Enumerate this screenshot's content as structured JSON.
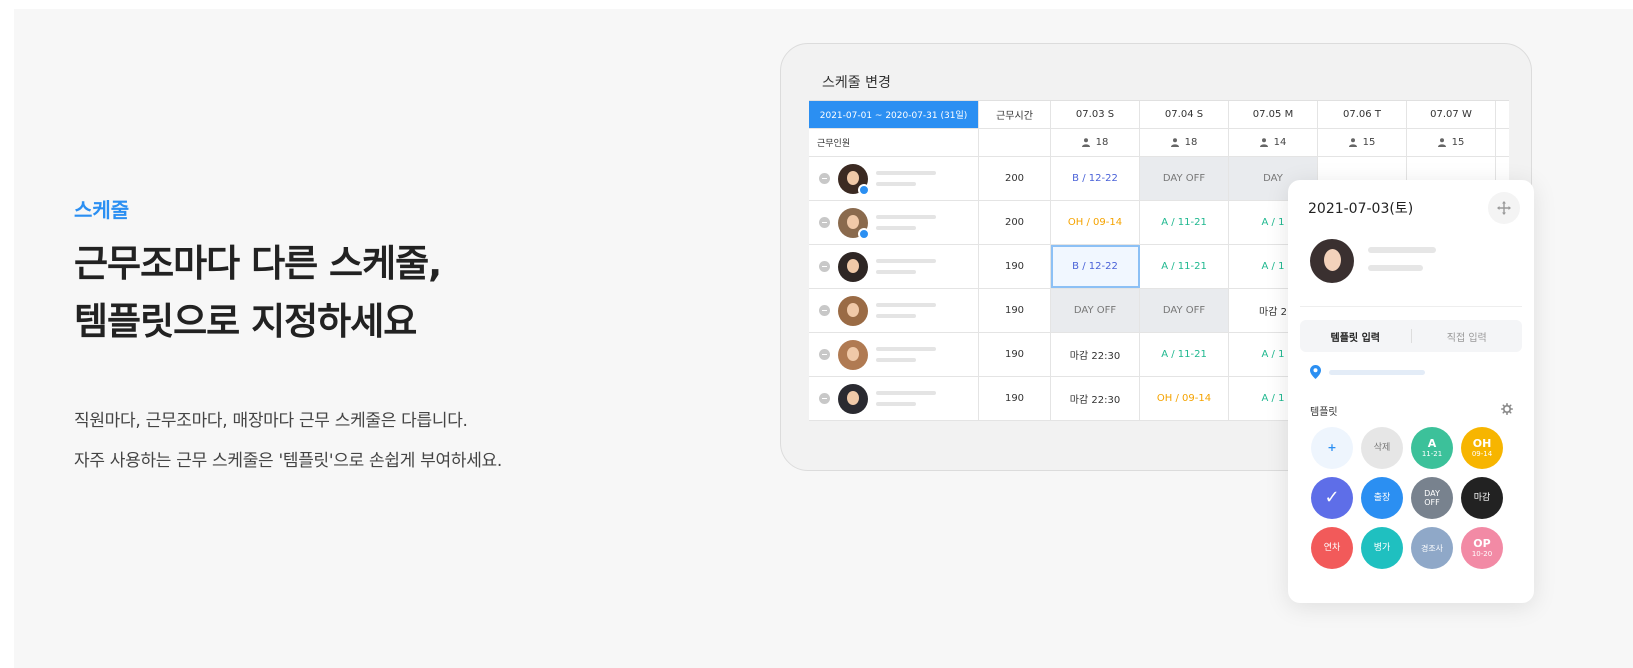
{
  "left": {
    "eyebrow": "스케줄",
    "headline_line1": "근무조마다 다른 스케줄,",
    "headline_line2": "템플릿으로 지정하세요",
    "desc_line1": "직원마다, 근무조마다, 매장마다 근무 스케줄은 다릅니다.",
    "desc_line2": "자주 사용하는 근무 스케줄은 '템플릿'으로 손쉽게 부여하세요."
  },
  "schedule": {
    "title": "스케줄 변경",
    "range": "2021-07-01 ~ 2020-07-31 (31일)",
    "hours_header": "근무시간",
    "dates": [
      "07.03 S",
      "07.04 S",
      "07.05 M",
      "07.06 T",
      "07.07 W"
    ],
    "staff_label": "근무인원",
    "counts": [
      "18",
      "18",
      "14",
      "15",
      "15"
    ],
    "rows": [
      {
        "hours": "200",
        "cells": [
          "B / 12-22",
          "DAY OFF",
          "DAY",
          "",
          ""
        ]
      },
      {
        "hours": "200",
        "cells": [
          "OH / 09-14",
          "A / 11-21",
          "A / 1",
          "",
          ""
        ]
      },
      {
        "hours": "190",
        "cells": [
          "B / 12-22",
          "A / 11-21",
          "A / 1",
          "",
          ""
        ]
      },
      {
        "hours": "190",
        "cells": [
          "DAY OFF",
          "DAY OFF",
          "마감 2",
          "",
          ""
        ]
      },
      {
        "hours": "190",
        "cells": [
          "마감 22:30",
          "A / 11-21",
          "A / 1",
          "",
          ""
        ]
      },
      {
        "hours": "190",
        "cells": [
          "마감 22:30",
          "OH / 09-14",
          "A / 1",
          "",
          ""
        ]
      }
    ]
  },
  "popup": {
    "date": "2021-07-03(토)",
    "tab_template": "템플릿 입력",
    "tab_direct": "직접 입력",
    "template_label": "템플릿",
    "chips": [
      {
        "top": "+",
        "bottom": "",
        "color": "#eef5fd",
        "text_color": "#2b8ff2"
      },
      {
        "top": "삭제",
        "bottom": "",
        "color": "#e6e6e6",
        "text_color": "#777777"
      },
      {
        "top": "A",
        "bottom": "11-21",
        "color": "#3cc19a",
        "text_color": "#ffffff"
      },
      {
        "top": "OH",
        "bottom": "09-14",
        "color": "#f7b500",
        "text_color": "#ffffff"
      },
      {
        "top": "✓",
        "bottom": "",
        "color": "#5e6ee8",
        "text_color": "#ffffff"
      },
      {
        "top": "출장",
        "bottom": "",
        "color": "#2b8ff2",
        "text_color": "#ffffff"
      },
      {
        "top": "DAY",
        "bottom": "OFF",
        "color": "#78828e",
        "text_color": "#ffffff"
      },
      {
        "top": "마감",
        "bottom": "",
        "color": "#222222",
        "text_color": "#ffffff"
      },
      {
        "top": "연차",
        "bottom": "",
        "color": "#f25a5a",
        "text_color": "#ffffff"
      },
      {
        "top": "병가",
        "bottom": "",
        "color": "#1fc0c0",
        "text_color": "#ffffff"
      },
      {
        "top": "경조사",
        "bottom": "",
        "color": "#8fa8c8",
        "text_color": "#ffffff"
      },
      {
        "top": "OP",
        "bottom": "10-20",
        "color": "#f28aa5",
        "text_color": "#ffffff"
      }
    ]
  },
  "colors": {
    "accent": "#2b8ff2"
  }
}
